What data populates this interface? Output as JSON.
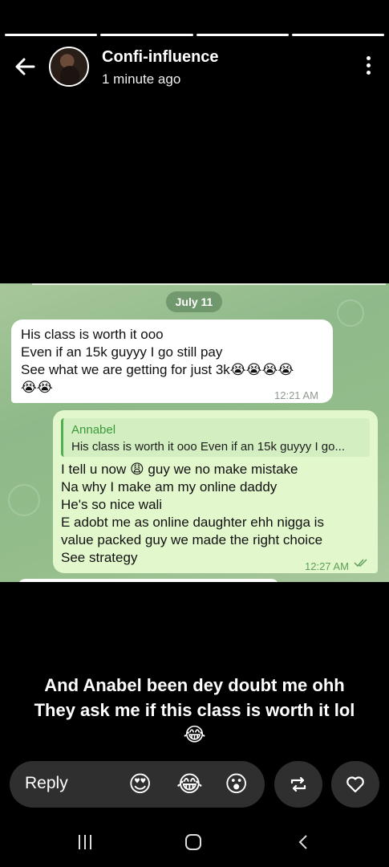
{
  "story": {
    "account_name": "Confi-influence",
    "posted_time": "1 minute ago",
    "progress_segments": 4
  },
  "chat": {
    "date_label": "July 11",
    "incoming": {
      "lines": [
        "His class is worth it ooo",
        "Even if an 15k guyyy I go still pay",
        "See what we are getting for just 3k😭😭😭😭",
        "😭😭"
      ],
      "time": "12:21 AM"
    },
    "outgoing": {
      "quote_name": "Annabel",
      "quote_text": "His class is worth it ooo Even if an 15k guyyy I go...",
      "lines": [
        "I tell u now 😩 guy we no make mistake",
        "Na why I make am my online daddy",
        "He's so nice wali",
        "E adobt me as online daughter ehh nigga is",
        "value packed guy we made the right choice",
        "See strategy"
      ],
      "time": "12:27 AM"
    }
  },
  "caption": {
    "line1": "And Anabel been dey doubt me ohh",
    "line2": "They ask me if this class is worth it lol",
    "emoji": "😂"
  },
  "reply_bar": {
    "placeholder": "Reply",
    "reactions": [
      "😍",
      "😂",
      "😮"
    ],
    "repost_icon": "repost-icon",
    "like_icon": "heart-icon"
  },
  "colors": {
    "chat_bg": "#98be8f",
    "incoming_bubble": "#ffffff",
    "outgoing_bubble": "#e2f7cb",
    "quote_accent": "#4fae4e"
  }
}
